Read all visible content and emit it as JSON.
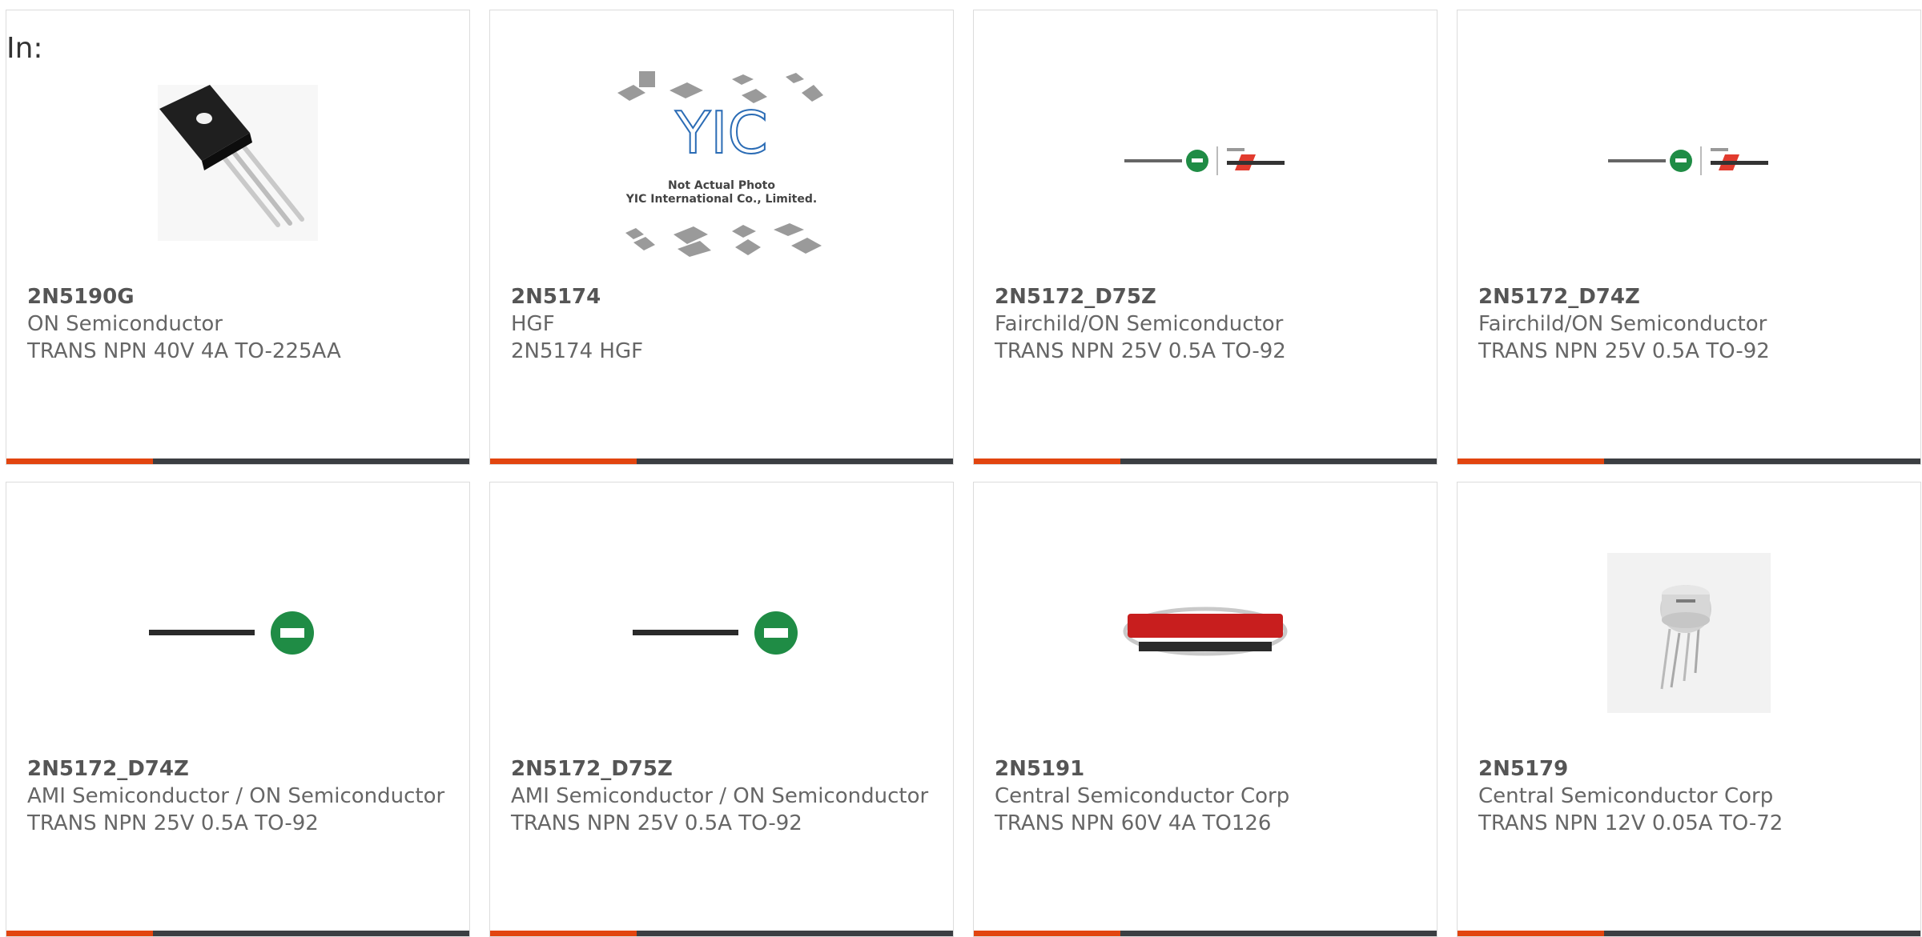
{
  "filter_label": "In:",
  "colors": {
    "accent": "#e2450f",
    "bar": "#3b3e42",
    "text": "#666666"
  },
  "products": [
    {
      "part": "2N5190G",
      "maker": "ON Semiconductor",
      "desc": "TRANS NPN 40V 4A TO-225AA",
      "image": "transistor-to225-photo"
    },
    {
      "part": "2N5174",
      "maker": "HGF",
      "desc": "2N5174 HGF",
      "image": "yic-placeholder",
      "image_text_1": "Not Actual Photo",
      "image_text_2": "YIC International Co., Limited.",
      "image_logo": "YIC"
    },
    {
      "part": "2N5172_D75Z",
      "maker": "Fairchild/ON Semiconductor",
      "desc": "TRANS NPN 25V 0.5A TO-92",
      "image": "on-fairchild-logo"
    },
    {
      "part": "2N5172_D74Z",
      "maker": "Fairchild/ON Semiconductor",
      "desc": "TRANS NPN 25V 0.5A TO-92",
      "image": "on-fairchild-logo"
    },
    {
      "part": "2N5172_D74Z",
      "maker": "AMI Semiconductor / ON Semiconductor",
      "desc": "TRANS NPN 25V 0.5A TO-92",
      "image": "on-semiconductor-logo"
    },
    {
      "part": "2N5172_D75Z",
      "maker": "AMI Semiconductor / ON Semiconductor",
      "desc": "TRANS NPN 25V 0.5A TO-92",
      "image": "on-semiconductor-logo"
    },
    {
      "part": "2N5191",
      "maker": "Central Semiconductor Corp",
      "desc": "TRANS NPN 60V 4A TO126",
      "image": "central-semiconductor-logo"
    },
    {
      "part": "2N5179",
      "maker": "Central Semiconductor Corp",
      "desc": "TRANS NPN 12V 0.05A TO-72",
      "image": "transistor-to72-photo"
    }
  ]
}
